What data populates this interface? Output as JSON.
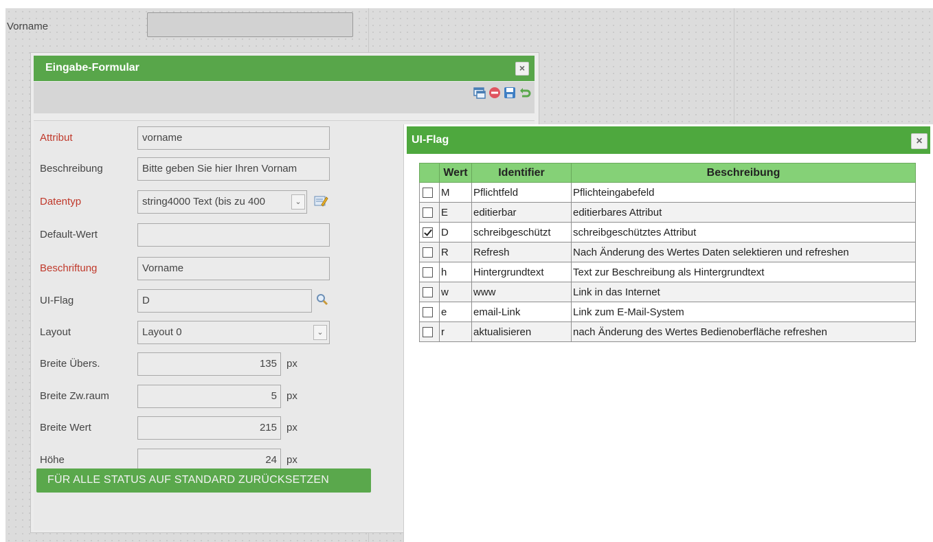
{
  "background": {
    "label": "Vorname"
  },
  "form": {
    "title": "Eingabe-Formular",
    "close_glyph": "×",
    "toolbar_icons": [
      "window-icon",
      "delete-icon",
      "save-icon",
      "undo-icon"
    ],
    "rows": [
      {
        "label": "Attribut",
        "required": true,
        "value": "vorname"
      },
      {
        "label": "Beschreibung",
        "required": false,
        "value": "Bitte geben Sie hier Ihren Vornam"
      },
      {
        "label": "Datentyp",
        "required": true,
        "value": "string4000 Text (bis zu 400"
      },
      {
        "label": "Default-Wert",
        "required": false,
        "value": ""
      },
      {
        "label": "Beschriftung",
        "required": true,
        "value": "Vorname"
      },
      {
        "label": "UI-Flag",
        "required": false,
        "value": "D"
      },
      {
        "label": "Layout",
        "required": false,
        "value": "Layout 0"
      },
      {
        "label": "Breite Übers.",
        "required": false,
        "value": "135",
        "unit": "px"
      },
      {
        "label": "Breite Zw.raum",
        "required": false,
        "value": "5",
        "unit": "px"
      },
      {
        "label": "Breite Wert",
        "required": false,
        "value": "215",
        "unit": "px"
      },
      {
        "label": "Höhe",
        "required": false,
        "value": "24",
        "unit": "px"
      }
    ],
    "reset_button": "FÜR ALLE STATUS AUF STANDARD ZURÜCKSETZEN"
  },
  "flag_dialog": {
    "title": "UI-Flag",
    "close_glyph": "×",
    "columns": [
      "Wert",
      "Identifier",
      "Beschreibung"
    ],
    "rows": [
      {
        "checked": false,
        "wert": "M",
        "identifier": "Pflichtfeld",
        "beschreibung": "Pflichteingabefeld"
      },
      {
        "checked": false,
        "wert": "E",
        "identifier": "editierbar",
        "beschreibung": "editierbares Attribut"
      },
      {
        "checked": true,
        "wert": "D",
        "identifier": "schreibgeschützt",
        "beschreibung": "schreibgeschütztes Attribut"
      },
      {
        "checked": false,
        "wert": "R",
        "identifier": "Refresh",
        "beschreibung": "Nach Änderung des Wertes Daten selektieren und refreshen"
      },
      {
        "checked": false,
        "wert": "h",
        "identifier": "Hintergrundtext",
        "beschreibung": "Text zur Beschreibung als Hintergrundtext"
      },
      {
        "checked": false,
        "wert": "w",
        "identifier": "www",
        "beschreibung": "Link in das Internet"
      },
      {
        "checked": false,
        "wert": "e",
        "identifier": "email-Link",
        "beschreibung": "Link zum E-Mail-System"
      },
      {
        "checked": false,
        "wert": "r",
        "identifier": "aktualisieren",
        "beschreibung": "nach Änderung des Wertes Bedienoberfläche refreshen"
      }
    ]
  },
  "colors": {
    "title_green": "#58a64a",
    "header_green": "#85d177",
    "required_red": "#c0392b"
  }
}
